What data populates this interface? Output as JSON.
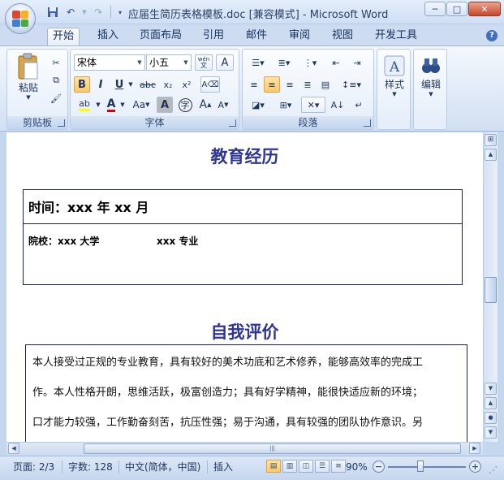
{
  "window": {
    "title": "应届生简历表格模板.doc [兼容模式] - Microsoft Word",
    "controls": {
      "minimize": "─",
      "maximize": "□",
      "close": "✕"
    }
  },
  "quick_access": {
    "save_icon": "save-icon",
    "undo_icon": "undo-icon",
    "redo_icon": "redo-icon"
  },
  "tabs": [
    "开始",
    "插入",
    "页面布局",
    "引用",
    "邮件",
    "审阅",
    "视图",
    "开发工具"
  ],
  "ribbon": {
    "clipboard": {
      "label": "剪贴板",
      "paste": "粘贴"
    },
    "font": {
      "label": "字体",
      "font_name": "宋体",
      "font_size": "小五",
      "bold": "B",
      "italic": "I",
      "underline": "U",
      "strike": "abc",
      "subscript": "x₂",
      "superscript": "x²",
      "font_color": "A",
      "change_case": "Aa",
      "char_shading": "A",
      "enclose": "字",
      "grow": "A",
      "shrink": "A",
      "phonetic": "wén",
      "border": "A"
    },
    "paragraph": {
      "label": "段落"
    },
    "styles": {
      "label": "样式"
    },
    "editing": {
      "label": "编辑"
    }
  },
  "document": {
    "education_heading": "教育经历",
    "edu_time": "时间：xxx 年 xx 月",
    "edu_school": "院校：xxx 大学",
    "edu_major": "xxx 专业",
    "self_eval_heading": "自我评价",
    "self_eval_lines": [
      "本人接受过正规的专业教育，具有较好的美术功底和艺术修养，能够高效率的完成工",
      "作。本人性格开朗，思维活跃，极富创造力；具有好学精神，能很快适应新的环境；",
      "口才能力较强，工作勤奋刻苦，抗压性强；易于沟通，具有较强的团队协作意识。另"
    ]
  },
  "statusbar": {
    "page": "页面: 2/3",
    "words": "字数: 128",
    "language": "中文(简体，中国)",
    "mode": "插入",
    "zoom": "90%",
    "zoom_percent": 90
  }
}
